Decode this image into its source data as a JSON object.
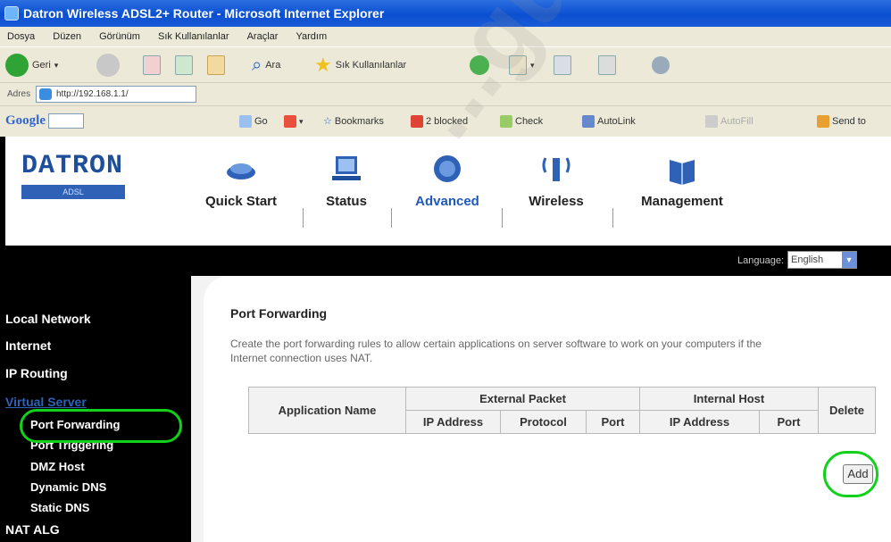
{
  "browser": {
    "title": "Datron Wireless ADSL2+ Router - Microsoft Internet Explorer",
    "menu": [
      "Dosya",
      "Düzen",
      "Görünüm",
      "Sık Kullanılanlar",
      "Araçlar",
      "Yardım"
    ],
    "toolbar": {
      "back_label": "Geri",
      "search_label": "Ara",
      "favorites_label": "Sık Kullanılanlar"
    },
    "address": {
      "label": "Adres",
      "url": "http://192.168.1.1/"
    },
    "google": {
      "logo": "Google",
      "go_label": "Go",
      "bookmarks_label": "Bookmarks",
      "blocked_label": "2 blocked",
      "check_label": "Check",
      "autolink_label": "AutoLink",
      "autofill_label": "AutoFill",
      "sendto_label": "Send to"
    }
  },
  "router": {
    "logo": {
      "word": "DATRON",
      "sub": "ADSL"
    },
    "nav": [
      "Quick Start",
      "Status",
      "Advanced",
      "Wireless",
      "Management"
    ],
    "language": {
      "label": "Language:",
      "value": "English"
    },
    "sidebar": {
      "items": [
        "Local Network",
        "Internet",
        "IP Routing",
        "Virtual Server",
        "NAT ALG"
      ],
      "sub_items": [
        "Port Forwarding",
        "Port Triggering",
        "DMZ Host",
        "Dynamic DNS",
        "Static DNS"
      ]
    },
    "panel": {
      "title": "Port Forwarding",
      "description": "Create the port forwarding rules to allow certain applications on server software to work on your computers if the Internet connection uses NAT.",
      "table": {
        "application_name": "Application Name",
        "external_packet": "External Packet",
        "internal_host": "Internal Host",
        "delete": "Delete",
        "ip_address": "IP Address",
        "protocol": "Protocol",
        "port": "Port"
      },
      "add_label": "Add"
    }
  },
  "watermark": "...guvenlik...",
  "colors": {
    "accent": "#1e58b8",
    "highlight_ring": "#11d11a",
    "ie_title": "#0a4fd0"
  }
}
